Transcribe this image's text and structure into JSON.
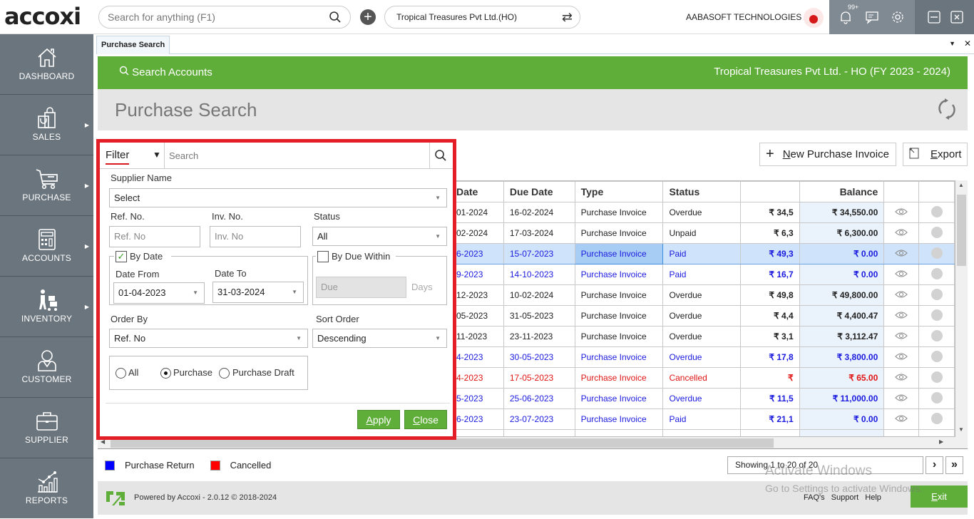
{
  "topbar": {
    "logo": "accoxi",
    "search_placeholder": "Search for anything (F1)",
    "company_selector": "Tropical Treasures Pvt Ltd.(HO)",
    "org_name": "AABASOFT TECHNOLOGIES",
    "notification_badge": "99+"
  },
  "sidebar": {
    "items": [
      {
        "label": "DASHBOARD",
        "icon": "home-icon",
        "submenu": false
      },
      {
        "label": "SALES",
        "icon": "shopping-bag-icon",
        "submenu": true
      },
      {
        "label": "PURCHASE",
        "icon": "cart-icon",
        "submenu": true
      },
      {
        "label": "ACCOUNTS",
        "icon": "calculator-icon",
        "submenu": true
      },
      {
        "label": "INVENTORY",
        "icon": "inventory-icon",
        "submenu": true
      },
      {
        "label": "CUSTOMER",
        "icon": "person-icon",
        "submenu": false
      },
      {
        "label": "SUPPLIER",
        "icon": "briefcase-icon",
        "submenu": false
      },
      {
        "label": "REPORTS",
        "icon": "chart-icon",
        "submenu": false
      }
    ]
  },
  "tabs": [
    {
      "label": "Purchase Search",
      "active": true
    }
  ],
  "header": {
    "search_accounts": "Search Accounts",
    "company_fy": "Tropical Treasures Pvt Ltd. - HO (FY 2023 - 2024)",
    "page_title": "Purchase Search"
  },
  "actions": {
    "new_invoice_prefix": "N",
    "new_invoice_rest": "ew Purchase Invoice",
    "export_prefix": "E",
    "export_rest": "xport"
  },
  "filter": {
    "label": "Filter",
    "search_placeholder": "Search",
    "supplier_name_label": "Supplier Name",
    "supplier_name_value": "Select",
    "ref_no_label": "Ref. No.",
    "ref_no_placeholder": "Ref. No",
    "inv_no_label": "Inv. No.",
    "inv_no_placeholder": "Inv. No",
    "status_label": "Status",
    "status_value": "All",
    "by_date_label": "By Date",
    "by_date_checked": true,
    "date_from_label": "Date From",
    "date_from_value": "01-04-2023",
    "date_to_label": "Date To",
    "date_to_value": "31-03-2024",
    "by_due_within_label": "By Due Within",
    "by_due_within_checked": false,
    "due_placeholder": "Due",
    "days_label": "Days",
    "order_by_label": "Order By",
    "order_by_value": "Ref. No",
    "sort_order_label": "Sort Order",
    "sort_order_value": "Descending",
    "type_options": [
      "All",
      "Purchase",
      "Purchase Draft"
    ],
    "type_selected": "Purchase",
    "apply_prefix": "A",
    "apply_rest": "pply",
    "close_prefix": "C",
    "close_rest": "lose"
  },
  "table": {
    "columns": [
      "Date",
      "Due Date",
      "Type",
      "Status",
      "",
      "Balance",
      "",
      ""
    ],
    "rows": [
      {
        "date": "01-2024",
        "due": "16-02-2024",
        "type": "Purchase Invoice",
        "status": "Overdue",
        "total": "₹ 34,5",
        "balance": "₹ 34,550.00",
        "style": "normal"
      },
      {
        "date": "02-2024",
        "due": "17-03-2024",
        "type": "Purchase Invoice",
        "status": "Unpaid",
        "total": "₹ 6,3",
        "balance": "₹ 6,300.00",
        "style": "normal"
      },
      {
        "date": "6-2023",
        "due": "15-07-2023",
        "type": "Purchase Invoice",
        "status": "Paid",
        "total": "₹ 49,3",
        "balance": "₹ 0.00",
        "style": "blue selected"
      },
      {
        "date": "9-2023",
        "due": "14-10-2023",
        "type": "Purchase Invoice",
        "status": "Paid",
        "total": "₹ 16,7",
        "balance": "₹ 0.00",
        "style": "blue"
      },
      {
        "date": "12-2023",
        "due": "10-02-2024",
        "type": "Purchase Invoice",
        "status": "Overdue",
        "total": "₹ 49,8",
        "balance": "₹ 49,800.00",
        "style": "normal"
      },
      {
        "date": "05-2023",
        "due": "31-05-2023",
        "type": "Purchase Invoice",
        "status": "Overdue",
        "total": "₹ 4,4",
        "balance": "₹ 4,400.47",
        "style": "normal"
      },
      {
        "date": "11-2023",
        "due": "23-11-2023",
        "type": "Purchase Invoice",
        "status": "Overdue",
        "total": "₹ 3,1",
        "balance": "₹ 3,112.47",
        "style": "normal"
      },
      {
        "date": "4-2023",
        "due": "30-05-2023",
        "type": "Purchase Invoice",
        "status": "Overdue",
        "total": "₹ 17,8",
        "balance": "₹ 3,800.00",
        "style": "blue"
      },
      {
        "date": "4-2023",
        "due": "17-05-2023",
        "type": "Purchase Invoice",
        "status": "Cancelled",
        "total": "₹",
        "balance": "₹ 65.00",
        "style": "red"
      },
      {
        "date": "5-2023",
        "due": "25-06-2023",
        "type": "Purchase Invoice",
        "status": "Overdue",
        "total": "₹ 11,5",
        "balance": "₹ 11,000.00",
        "style": "blue"
      },
      {
        "date": "6-2023",
        "due": "23-07-2023",
        "type": "Purchase Invoice",
        "status": "Paid",
        "total": "₹ 21,1",
        "balance": "₹ 0.00",
        "style": "blue"
      }
    ]
  },
  "legend": [
    {
      "label": "Purchase Return",
      "color": "#0000ff"
    },
    {
      "label": "Cancelled",
      "color": "#ff0000"
    }
  ],
  "pager": {
    "text": "Showing 1 to 20 of 20"
  },
  "footer": {
    "powered_by": "Powered by Accoxi - 2.0.12 © 2018-2024",
    "links": [
      "FAQ's",
      "Support",
      "Help"
    ],
    "exit_prefix": "E",
    "exit_rest": "xit"
  },
  "watermark": {
    "line1": "Activate Windows",
    "line2": "Go to Settings to activate Windows."
  },
  "colors": {
    "brand_green": "#5fae3a",
    "highlight_red": "#e41e26",
    "sidebar": "#6b757d"
  }
}
